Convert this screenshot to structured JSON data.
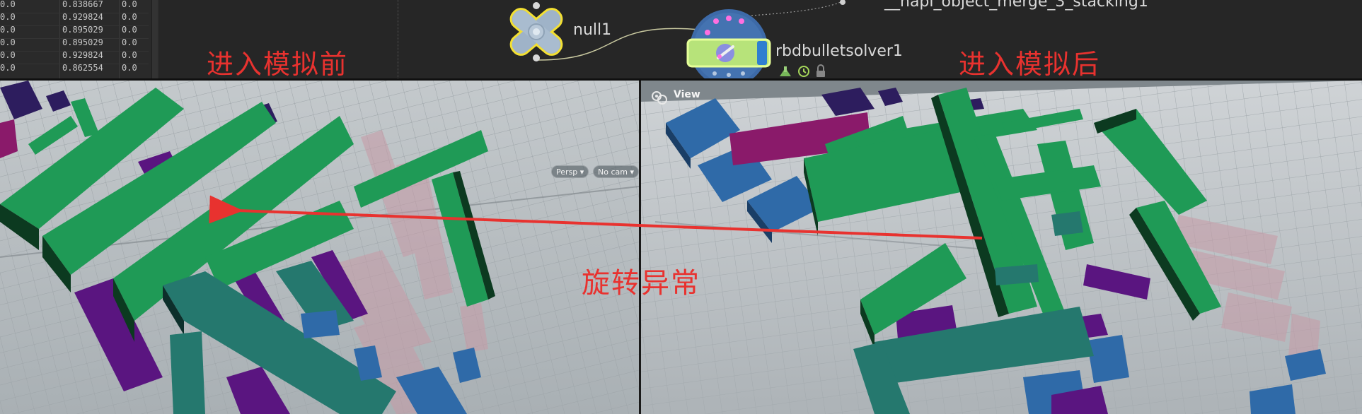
{
  "spreadsheet": {
    "rows": [
      {
        "a": "0.0",
        "b": "0.838667",
        "c": "0.0"
      },
      {
        "a": "0.0",
        "b": "0.929824",
        "c": "0.0"
      },
      {
        "a": "0.0",
        "b": "0.895029",
        "c": "0.0"
      },
      {
        "a": "0.0",
        "b": "0.895029",
        "c": "0.0"
      },
      {
        "a": "0.0",
        "b": "0.929824",
        "c": "0.0"
      },
      {
        "a": "0.0",
        "b": "0.862554",
        "c": "0.0"
      }
    ]
  },
  "network": {
    "null_node": {
      "name": "null1",
      "icon": "null-node-icon",
      "color": "#f3e033"
    },
    "solver_node": {
      "name": "rbdbulletsolver1",
      "icon": "rbd-solver-node-icon",
      "color": "#b7e37a"
    },
    "merge_node": {
      "name": "__hapi_object_merge_3_stacking1"
    },
    "flag_icons": [
      "export-flag-icon",
      "timer-flag-icon",
      "lock-flag-icon"
    ]
  },
  "annotations": {
    "before_label": "进入模拟前",
    "after_label": "进入模拟后",
    "anomaly_label": "旋转异常",
    "color": "#e8322f"
  },
  "viewport_left": {
    "persp_label": "Persp",
    "cam_label": "No cam"
  },
  "viewport_right": {
    "view_label": "View"
  }
}
